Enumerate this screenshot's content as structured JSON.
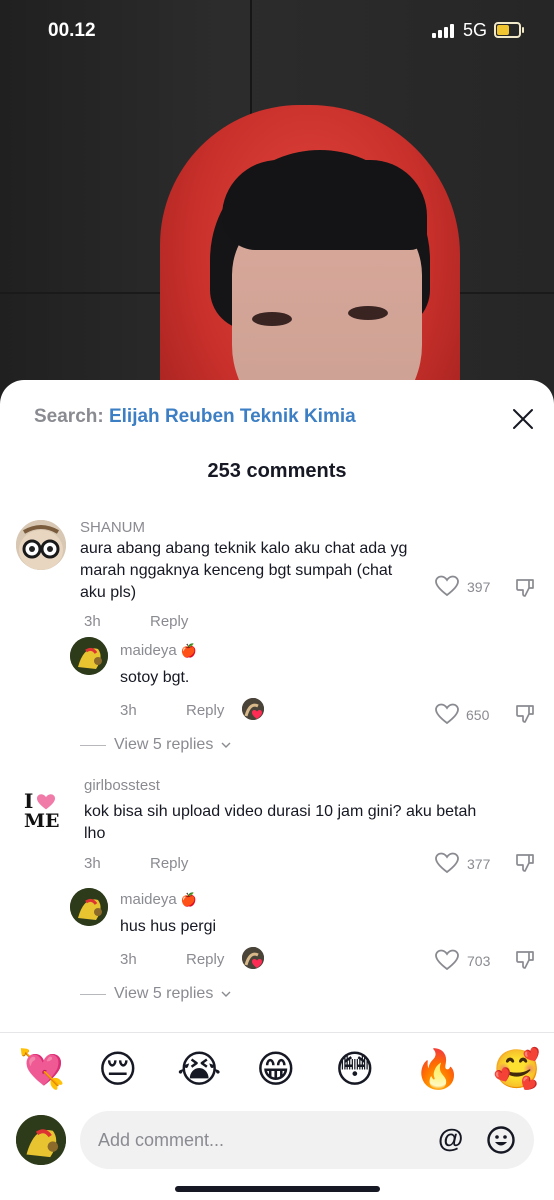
{
  "status_bar": {
    "time": "00.12",
    "network": "5G"
  },
  "search": {
    "label": "Search:",
    "query": "Elijah Reuben Teknik Kimia"
  },
  "comments_count": "253 comments",
  "comments": [
    {
      "username": "SHANUM",
      "text_lines": [
        "aura abang abang teknik kalo aku chat ada yg",
        "marah nggaknya kenceng bgt sumpah (chat",
        "aku pls)"
      ],
      "time": "3h",
      "reply_label": "Reply",
      "likes": "397",
      "reply": {
        "username": "maideya",
        "badge": "🍎",
        "text": "sotoy bgt.",
        "time": "3h",
        "reply_label": "Reply",
        "likes": "650"
      },
      "view_replies": "View 5 replies"
    },
    {
      "username": "girlbosstest",
      "avatar_text": [
        "I",
        "ME"
      ],
      "text_lines": [
        "kok bisa sih upload video durasi 10 jam gini? aku betah",
        "lho"
      ],
      "time": "3h",
      "reply_label": "Reply",
      "likes": "377",
      "reply": {
        "username": "maideya",
        "badge": "🍎",
        "text": "hus hus pergi",
        "time": "3h",
        "reply_label": "Reply",
        "likes": "703"
      },
      "view_replies": "View 5 replies"
    }
  ],
  "emoji_bar": [
    "💘",
    "😔",
    "😭",
    "😁",
    "😳",
    "🔥",
    "🥰"
  ],
  "input": {
    "placeholder": "Add comment...",
    "at_symbol": "@"
  },
  "colors": {
    "accent_link": "#3d7fc4",
    "muted": "#8a8b91",
    "text": "#161823",
    "battery": "#f0c530"
  }
}
